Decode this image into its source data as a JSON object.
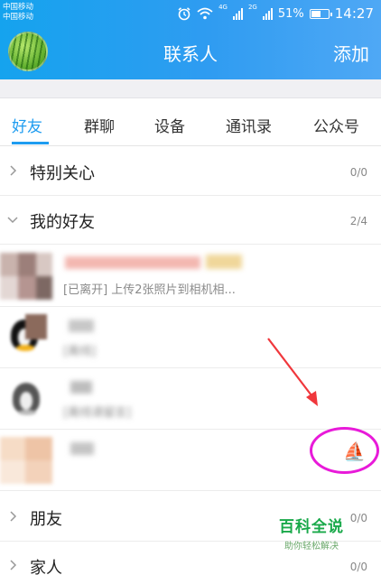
{
  "status_bar": {
    "carrier_1": "中国移动",
    "carrier_2": "中国移动",
    "net_1": "4G",
    "net_2": "2G",
    "battery": "51%",
    "time": "14:27"
  },
  "header": {
    "title": "联系人",
    "add_label": "添加"
  },
  "tabs": [
    {
      "label": "好友",
      "active": true
    },
    {
      "label": "群聊",
      "active": false
    },
    {
      "label": "设备",
      "active": false
    },
    {
      "label": "通讯录",
      "active": false
    },
    {
      "label": "公众号",
      "active": false
    }
  ],
  "groups": {
    "special": {
      "label": "特别关心",
      "count": "0/0",
      "expanded": false
    },
    "my_friends": {
      "label": "我的好友",
      "count": "2/4",
      "expanded": true
    },
    "friends": {
      "label": "朋友",
      "count": "0/0",
      "expanded": false
    },
    "family": {
      "label": "家人",
      "count": "0/0",
      "expanded": false
    }
  },
  "friends": [
    {
      "status": "[已离开] 上传2张照片到相机相..."
    },
    {
      "status": "[离线]"
    },
    {
      "status": "[离线请留言]"
    },
    {
      "status": ""
    }
  ],
  "watermark": {
    "main": "百科全说",
    "sub": "助你轻松解决"
  },
  "colors": {
    "header": "#2f9cf1",
    "accent": "#1e9cf0",
    "annotation_arrow": "#f0373c",
    "annotation_circle": "#e81ad9",
    "watermark": "#19a94a"
  },
  "icons": {
    "status_icon": "sailboat-icon"
  }
}
